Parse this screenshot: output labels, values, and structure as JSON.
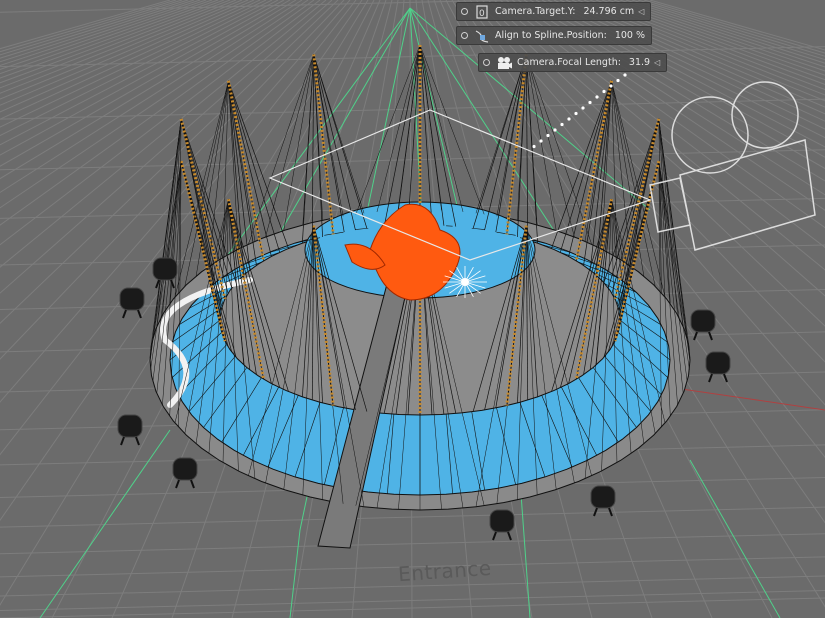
{
  "hud": {
    "items": [
      {
        "label": "Camera.Target.Y:",
        "value": "24.796 cm",
        "icon": "target-icon"
      },
      {
        "label": "Align to Spline.Position:",
        "value": "100 %",
        "icon": "spline-icon"
      },
      {
        "label": "Camera.Focal Length:",
        "value": "31.9",
        "icon": "camera-icon"
      }
    ]
  },
  "scene": {
    "entrance_label": "Entrance"
  },
  "colors": {
    "background": "#6b6b6b",
    "grid": "#7d7d7d",
    "floor_blue": "#4fb3e6",
    "fire": "#ff5a10",
    "wire": "#111111",
    "guide": "#4fd18a"
  }
}
